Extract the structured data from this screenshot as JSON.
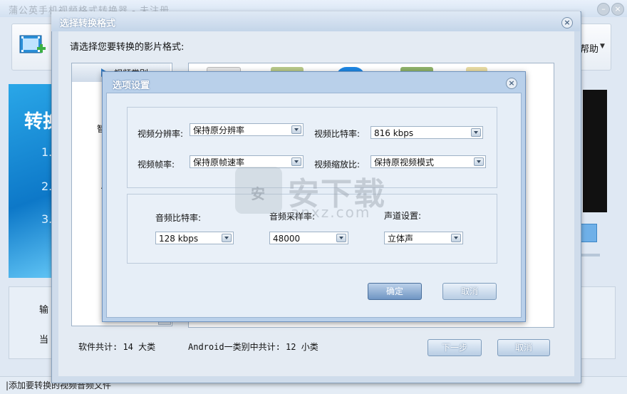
{
  "main": {
    "title": "蒲公英手机视频格式转换器 - 未注册",
    "help_label": "帮助",
    "banner_text": "转换",
    "banner_steps": [
      "1.",
      "2.",
      "3."
    ],
    "bottom_labels": [
      "输",
      "当"
    ],
    "status_text": "|添加要转换的视频音频文件"
  },
  "format_dialog": {
    "title": "选择转换格式",
    "prompt": "请选择您要转换的影片格式:",
    "categories": {
      "selected": "视频类别",
      "items": [
        "智",
        "A",
        "i"
      ]
    },
    "summary_software": "软件共计: 14   大类",
    "summary_android": "Android一类别中共计:   12   小类",
    "next_label": "下一步",
    "cancel_label": "取消"
  },
  "options_dialog": {
    "title": "选项设置",
    "video": {
      "resolution_label": "视频分辨率:",
      "resolution_value": "保持原分辨率",
      "bitrate_label": "视频比特率:",
      "bitrate_value": "816 kbps",
      "framerate_label": "视频帧率:",
      "framerate_value": "保持原帧速率",
      "scale_label": "视频缩放比:",
      "scale_value": "保持原视频模式"
    },
    "audio": {
      "bitrate_label": "音频比特率:",
      "bitrate_value": "128 kbps",
      "samplerate_label": "音频采样率:",
      "samplerate_value": "48000",
      "channel_label": "声道设置:",
      "channel_value": "立体声"
    },
    "ok_label": "确定",
    "cancel_label": "取消"
  },
  "watermark": {
    "shield_char": "安",
    "text": "安下载",
    "sub": "anxz.com"
  },
  "colors": {
    "accent": "#2f79c2",
    "dialog_bg": "#b9d0ea"
  }
}
